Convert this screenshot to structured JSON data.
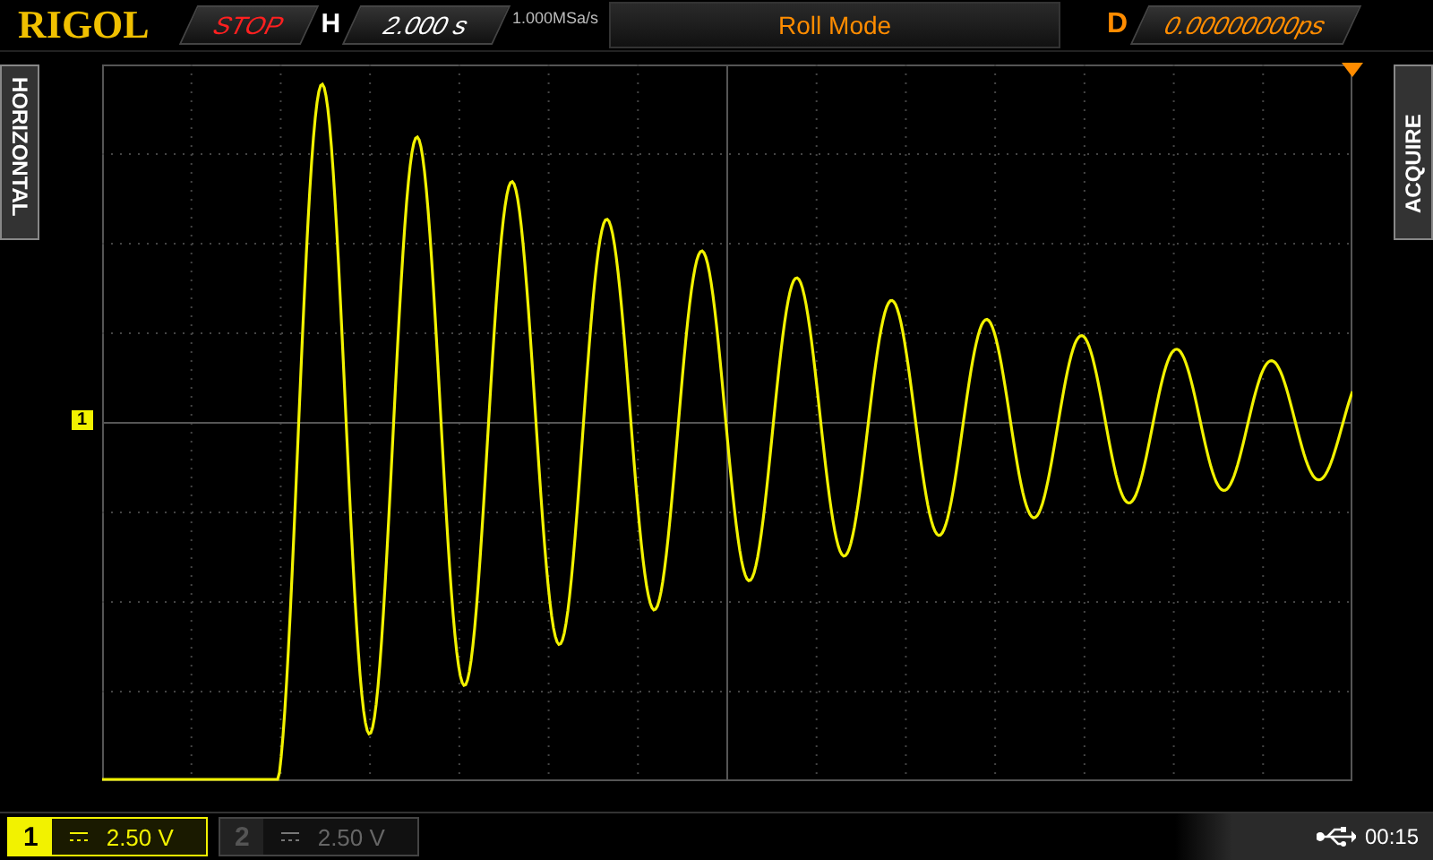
{
  "top_bar": {
    "brand": "RIGOL",
    "run_state": "STOP",
    "horizontal_label": "H",
    "timebase": "2.000 s",
    "sample_rate": "1.000MSa/s",
    "mode": "Roll Mode",
    "delay_label": "D",
    "delay": "0.00000000ps"
  },
  "side_tabs": {
    "left": "HORIZONTAL",
    "right": "ACQUIRE"
  },
  "channel_marker": "1",
  "channels": [
    {
      "label": "1",
      "scale": "2.50 V",
      "on": true
    },
    {
      "label": "2",
      "scale": "2.50 V",
      "on": false
    }
  ],
  "status": {
    "time": "00:15"
  }
}
